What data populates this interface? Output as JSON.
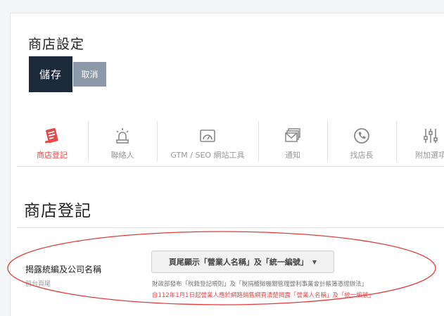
{
  "page": {
    "title": "商店設定"
  },
  "toolbar": {
    "save_label": "儲存",
    "cancel_label": "取消"
  },
  "tabs": [
    {
      "label": "商店登記",
      "icon": "store-register-icon",
      "active": true
    },
    {
      "label": "聯絡人",
      "icon": "alarm-light-icon",
      "active": false
    },
    {
      "label": "GTM / SEO 網站工具",
      "icon": "web-tool-icon",
      "active": false
    },
    {
      "label": "通知",
      "icon": "mail-stack-icon",
      "active": false
    },
    {
      "label": "找店長",
      "icon": "phone-icon",
      "active": false
    },
    {
      "label": "附加選項",
      "icon": "sliders-icon",
      "active": false
    }
  ],
  "section": {
    "title": "商店登記"
  },
  "field": {
    "label": "揭露統編及公司名稱",
    "sublabel": "前台頁尾",
    "select_value": "頁尾顯示「營業人名稱」及「統一編號」",
    "help_text": "財政部發布「稅籍登記規則」及「稅捐稽徵機關管理營利事業會計帳簿憑證辦法」",
    "warning_text": "自112年1月1日起營業人應於網路銷售網頁清楚揭露「營業人名稱」及「統一編號」"
  },
  "colors": {
    "accent": "#e24b4b",
    "primary_button": "#1c2a3a",
    "secondary_button": "#8d99a8",
    "annotation": "#e23c3c"
  }
}
